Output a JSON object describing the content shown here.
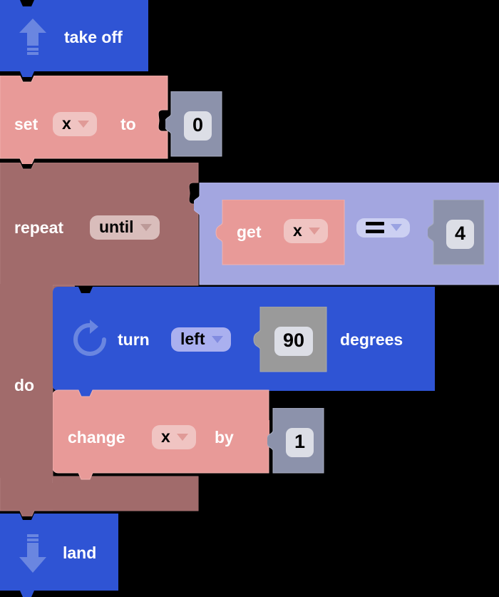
{
  "workspace": {
    "background_color": "#000000",
    "program_name": "drone-blockly-program"
  },
  "colors": {
    "motion_blue": "#2f54d4",
    "variable_pink": "#e89a98",
    "loop_mauve": "#a16b6b",
    "logic_purple": "#a3a6e0",
    "number_gray": "#8c92ab",
    "number_gray_light": "#9a9a9a",
    "field_text": "#000000",
    "block_text": "#ffffff"
  },
  "blocks": [
    {
      "id": "take-off",
      "type": "drone-takeoff",
      "label": "take off",
      "icon": "arrow-up-takeoff-icon",
      "category": "motion"
    },
    {
      "id": "set-variable",
      "type": "variables-set",
      "label_before": "set",
      "label_after": "to",
      "variable": "x",
      "value": "0",
      "category": "variable"
    },
    {
      "id": "repeat-until",
      "type": "controls-repeat-until",
      "label_repeat": "repeat",
      "mode": "until",
      "label_do": "do",
      "category": "loop"
    },
    {
      "id": "compare",
      "type": "logic-compare",
      "operator": "=",
      "category": "logic"
    },
    {
      "id": "get-variable",
      "type": "variables-get",
      "label": "get",
      "variable": "x",
      "category": "variable"
    },
    {
      "id": "compare-right-number",
      "type": "math-number",
      "value": "4",
      "category": "number"
    },
    {
      "id": "turn",
      "type": "drone-turn",
      "label_before": "turn",
      "direction": "left",
      "amount": "90",
      "label_after": "degrees",
      "icon": "rotate-clockwise-icon",
      "category": "motion"
    },
    {
      "id": "change-variable",
      "type": "variables-change",
      "label_before": "change",
      "label_after": "by",
      "variable": "x",
      "value": "1",
      "category": "variable"
    },
    {
      "id": "land",
      "type": "drone-land",
      "label": "land",
      "icon": "arrow-down-land-icon",
      "category": "motion"
    }
  ],
  "text": {
    "take_off": "take off",
    "set": "set",
    "to": "to",
    "var_x": "x",
    "num_zero": "0",
    "repeat": "repeat",
    "until": "until",
    "do": "do",
    "get": "get",
    "operator_eq": "=",
    "num_four": "4",
    "turn": "turn",
    "left": "left",
    "num_ninety": "90",
    "degrees": "degrees",
    "change": "change",
    "by": "by",
    "num_one": "1",
    "land": "land"
  }
}
